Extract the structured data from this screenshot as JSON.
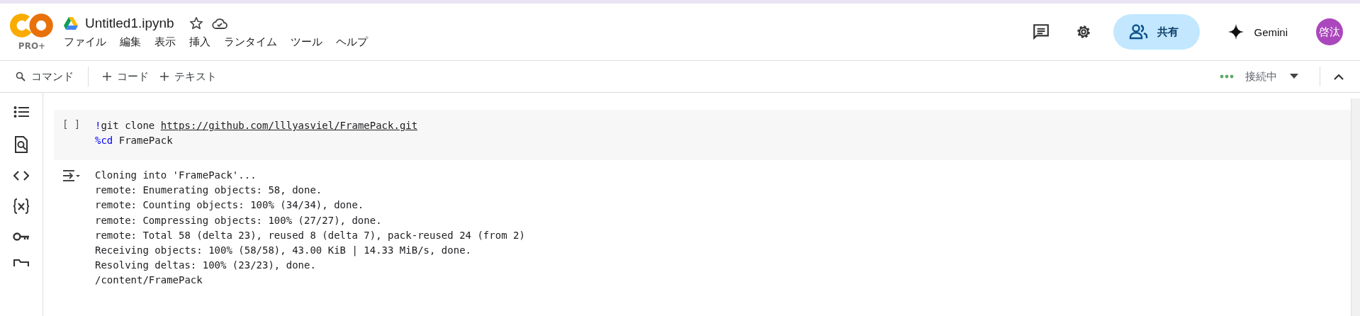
{
  "logo": {
    "badge": "PRO+"
  },
  "notebook": {
    "title": "Untitled1.ipynb",
    "starred": false
  },
  "menu": [
    "ファイル",
    "編集",
    "表示",
    "挿入",
    "ランタイム",
    "ツール",
    "ヘルプ"
  ],
  "header_actions": {
    "share": "共有",
    "gemini": "Gemini",
    "avatar": "啓汰"
  },
  "toolbar": {
    "command": "コマンド",
    "add_code": "コード",
    "add_text": "テキスト",
    "status": "接続中"
  },
  "sidebar": [
    {
      "kind": "toc"
    },
    {
      "kind": "find"
    },
    {
      "kind": "code"
    },
    {
      "kind": "variables"
    },
    {
      "kind": "secrets"
    },
    {
      "kind": "files"
    }
  ],
  "cell": {
    "prompt": "[ ]",
    "code": [
      [
        {
          "kind": "magic",
          "text": "!"
        },
        {
          "kind": "plain",
          "text": "git clone "
        },
        {
          "kind": "link",
          "text": "https://github.com/lllyasviel/FramePack.git"
        }
      ],
      [
        {
          "kind": "magic",
          "text": "%cd"
        },
        {
          "kind": "plain",
          "text": " FramePack"
        }
      ]
    ],
    "output": [
      "Cloning into 'FramePack'...",
      "remote: Enumerating objects: 58, done.",
      "remote: Counting objects: 100% (34/34), done.",
      "remote: Compressing objects: 100% (27/27), done.",
      "remote: Total 58 (delta 23), reused 8 (delta 7), pack-reused 24 (from 2)",
      "Receiving objects: 100% (58/58), 43.00 KiB | 14.33 MiB/s, done.",
      "Resolving deltas: 100% (23/23), done.",
      "/content/FramePack"
    ]
  }
}
